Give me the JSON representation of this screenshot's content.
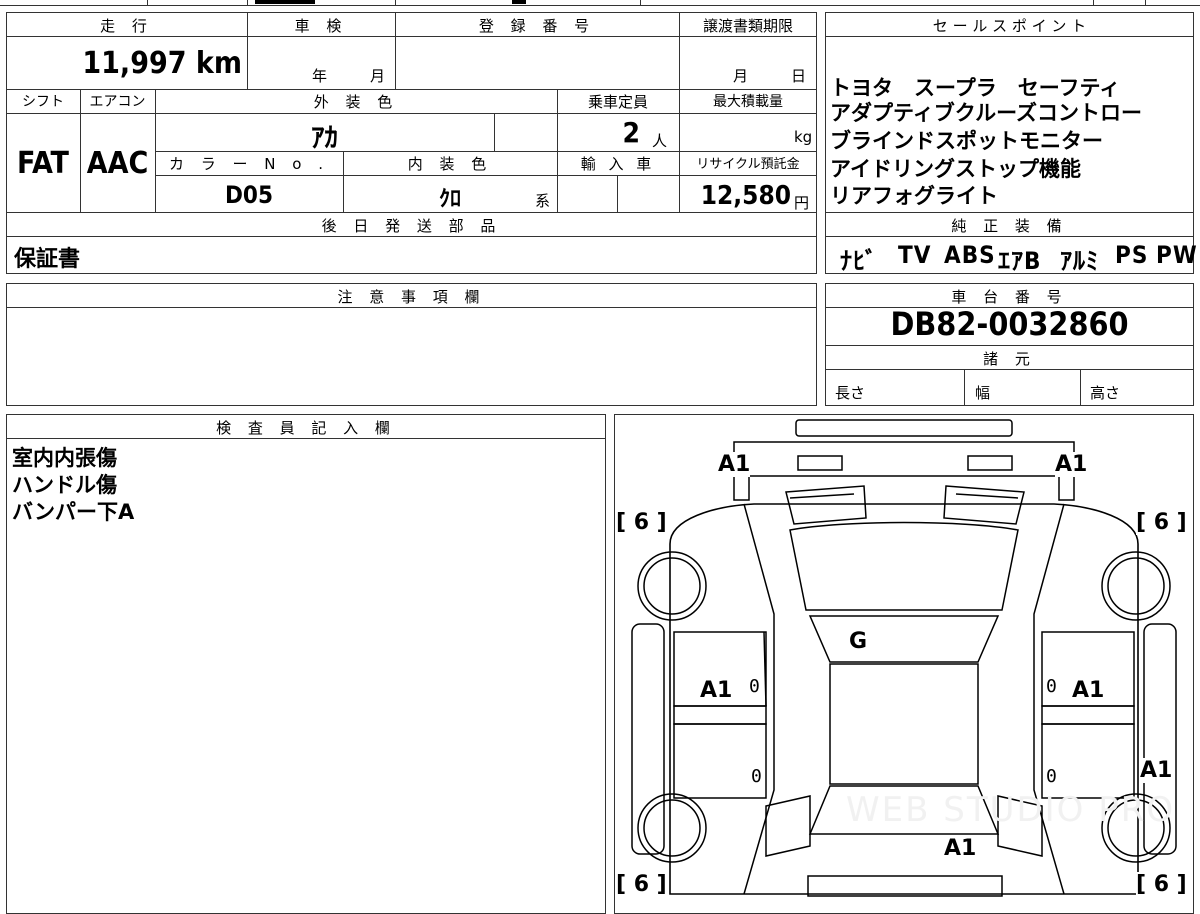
{
  "headers": {
    "mileage": "走 行",
    "inspection": "車 検",
    "registration": "登 録 番 号",
    "transfer_deadline": "譲渡書類期限",
    "sales_points": "セ ー ル ス ポ イ ン ト",
    "shift": "シフト",
    "aircon": "エアコン",
    "exterior_color": "外 装 色",
    "capacity": "乗車定員",
    "max_load": "最大積載量",
    "color_no": "カ ラ ー N o .",
    "interior_color": "内 装 色",
    "imported": "輸 入 車",
    "recycle_fee": "リサイクル預託金",
    "later_parts": "後 日 発 送 部 品",
    "standard_equipment": "純 正 装 備",
    "notes": "注 意 事 項 欄",
    "chassis_number": "車 台 番 号",
    "specs": "諸 元",
    "inspector_notes": "検 査 員 記 入 欄"
  },
  "values": {
    "mileage": "11,997",
    "mileage_unit": "km",
    "inspection_year_label": "年",
    "inspection_month_label": "月",
    "transfer_month_label": "月",
    "transfer_day_label": "日",
    "shift": "FAT",
    "aircon": "AAC",
    "exterior_color": "ｱｶ",
    "capacity": "2",
    "capacity_unit": "人",
    "max_load_unit": "kg",
    "color_no": "D05",
    "interior_color": "ｸﾛ",
    "interior_suffix": "系",
    "recycle_fee": "12,580",
    "recycle_unit": "円",
    "later_parts": "保証書",
    "chassis_number": "DB82-0032860",
    "spec_length": "長さ",
    "spec_width": "幅",
    "spec_height": "高さ"
  },
  "sales_points": [
    "トヨタ　スープラ　セーフティ",
    "アダプティブクルーズコントロー",
    "ブラインドスポットモニター",
    "アイドリングストップ機能",
    "リアフォグライト"
  ],
  "standard_equipment": [
    "ﾅﾋﾞ",
    "TV",
    "ABS",
    "ｴｱB",
    "ｱﾙﾐ",
    "PS",
    "PW"
  ],
  "inspector_lines": [
    "室内内張傷",
    "ハンドル傷",
    "バンパー下A"
  ],
  "diagram_marks": {
    "front_left": "A1",
    "front_right": "A1",
    "tire_fl": "[ 6 ]",
    "tire_fr": "[ 6 ]",
    "tire_rl": "[ 6 ]",
    "tire_rr": "[ 6 ]",
    "windshield": "G",
    "left_door": "A1",
    "right_door": "A1",
    "right_rear": "A1",
    "rear": "A1",
    "zero_1": "0",
    "zero_2": "0",
    "zero_3": "0",
    "zero_4": "0"
  },
  "watermark": "WEB STUDIO PRO"
}
